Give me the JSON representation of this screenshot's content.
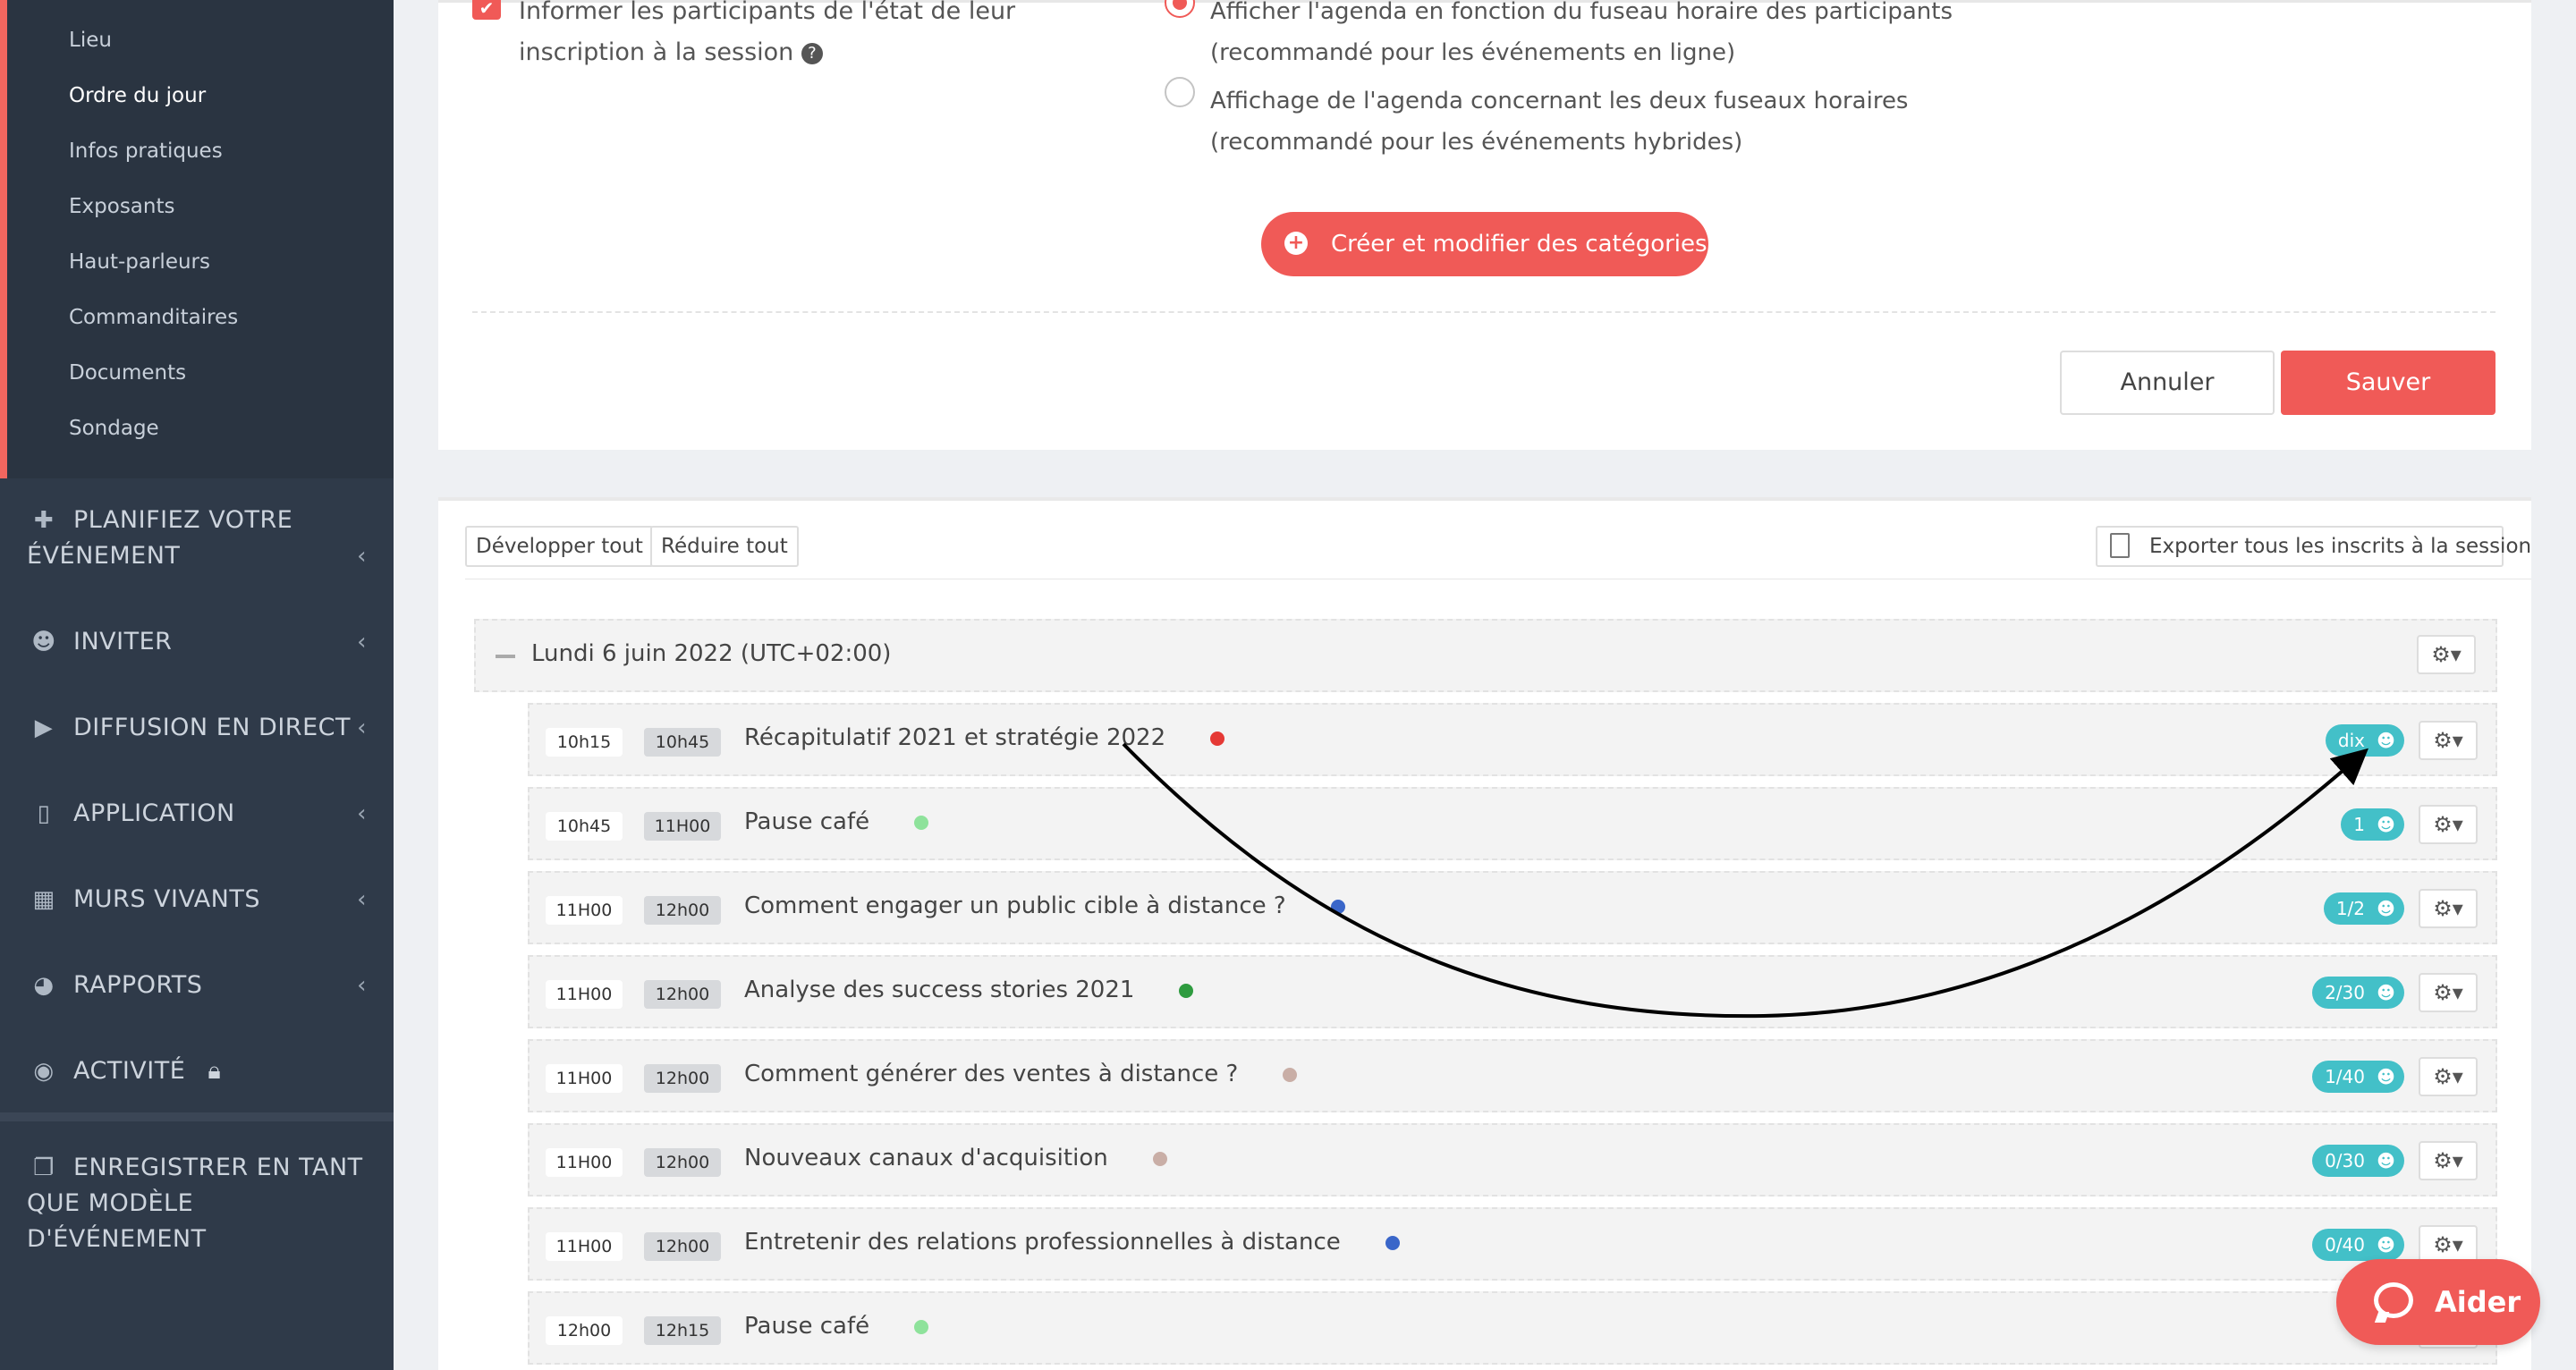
{
  "sidebar": {
    "submenu": [
      {
        "label": "Lieu",
        "active": false
      },
      {
        "label": "Ordre du jour",
        "active": true
      },
      {
        "label": "Infos pratiques",
        "active": false
      },
      {
        "label": "Exposants",
        "active": false
      },
      {
        "label": "Haut-parleurs",
        "active": false
      },
      {
        "label": "Commanditaires",
        "active": false
      },
      {
        "label": "Documents",
        "active": false
      },
      {
        "label": "Sondage",
        "active": false
      }
    ],
    "main": [
      {
        "label": "PLANIFIEZ VOTRE",
        "label2": "ÉVÉNEMENT",
        "icon": "puzzle-icon"
      },
      {
        "label": "INVITER",
        "icon": "users-icon"
      },
      {
        "label": "DIFFUSION EN DIRECT",
        "icon": "play-icon"
      },
      {
        "label": "APPLICATION",
        "icon": "mobile-icon"
      },
      {
        "label": "MURS VIVANTS",
        "icon": "film-icon"
      },
      {
        "label": "RAPPORTS",
        "icon": "pie-chart-icon"
      },
      {
        "label": "ACTIVITÉ",
        "icon": "eye-icon"
      }
    ],
    "template": {
      "label": "ENREGISTRER EN TANT",
      "label2": "QUE MODÈLE D'ÉVÉNEMENT",
      "icon": "copy-icon"
    }
  },
  "settings": {
    "notify_label": "Informer les participants de l'état de leur inscription à la session",
    "options": [
      {
        "line1": "Afficher l'agenda en fonction du fuseau horaire des participants",
        "line2": "(recommandé pour les événements en ligne)",
        "selected": true
      },
      {
        "line1": "Affichage de l'agenda concernant les deux fuseaux horaires",
        "line2": "(recommandé pour les événements hybrides)",
        "selected": false
      }
    ],
    "categories_button": "Créer et modifier des catégories",
    "cancel_label": "Annuler",
    "save_label": "Sauver"
  },
  "agenda": {
    "expand_all": "Développer tout",
    "collapse_all": "Réduire tout",
    "export_label": "Exporter tous les inscrits à la session",
    "day_label": "Lundi 6 juin 2022 (UTC+02:00)",
    "sessions": [
      {
        "start": "10h15",
        "end": "10h45",
        "title": "Récapitulatif 2021 et stratégie 2022",
        "dot_color": "#e53935",
        "badge": "dix"
      },
      {
        "start": "10h45",
        "end": "11H00",
        "title": "Pause café",
        "dot_color": "#8ee29b",
        "badge": "1"
      },
      {
        "start": "11H00",
        "end": "12h00",
        "title": "Comment engager un public cible à distance ?",
        "dot_color": "#3a66c9",
        "badge": "1/2"
      },
      {
        "start": "11H00",
        "end": "12h00",
        "title": "Analyse des success stories 2021",
        "dot_color": "#2e9b3f",
        "badge": "2/30"
      },
      {
        "start": "11H00",
        "end": "12h00",
        "title": "Comment générer des ventes à distance ?",
        "dot_color": "#c9aea6",
        "badge": "1/40"
      },
      {
        "start": "11H00",
        "end": "12h00",
        "title": "Nouveaux canaux d'acquisition",
        "dot_color": "#c9aea6",
        "badge": "0/30"
      },
      {
        "start": "11H00",
        "end": "12h00",
        "title": "Entretenir des relations professionnelles à distance",
        "dot_color": "#3a66c9",
        "badge": "0/40"
      },
      {
        "start": "12h00",
        "end": "12h15",
        "title": "Pause café",
        "dot_color": "#8ee29b",
        "badge": ""
      }
    ]
  },
  "help": {
    "label": "Aider"
  },
  "colors": {
    "accent": "#f05a57",
    "badge": "#43c0c8",
    "sidebar": "#2f3a49"
  }
}
